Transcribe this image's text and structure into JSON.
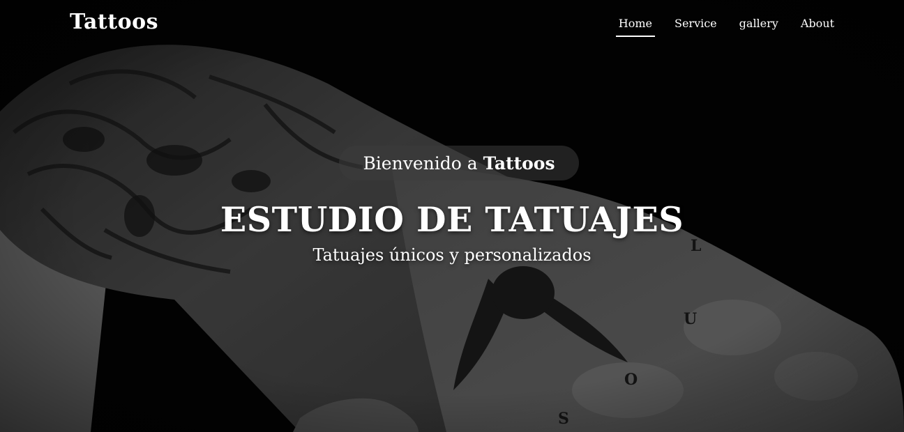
{
  "brand": {
    "name": "Tattoos"
  },
  "nav": {
    "items": [
      {
        "label": "Home",
        "active": true
      },
      {
        "label": "Service",
        "active": false
      },
      {
        "label": "gallery",
        "active": false
      },
      {
        "label": "About",
        "active": false
      }
    ]
  },
  "hero": {
    "welcome_prefix": "Bienvenido a",
    "welcome_brand": "Tattoos",
    "title": "ESTUDIO DE TATUAJES",
    "subtitle": "Tatuajes únicos y personalizados",
    "image_letters": [
      "S",
      "O",
      "U",
      "L"
    ]
  },
  "colors": {
    "text": "#ffffff",
    "background": "#050505",
    "skin_tone": "#6e6e6e",
    "pill_background": "rgba(60,60,60,0.55)"
  }
}
